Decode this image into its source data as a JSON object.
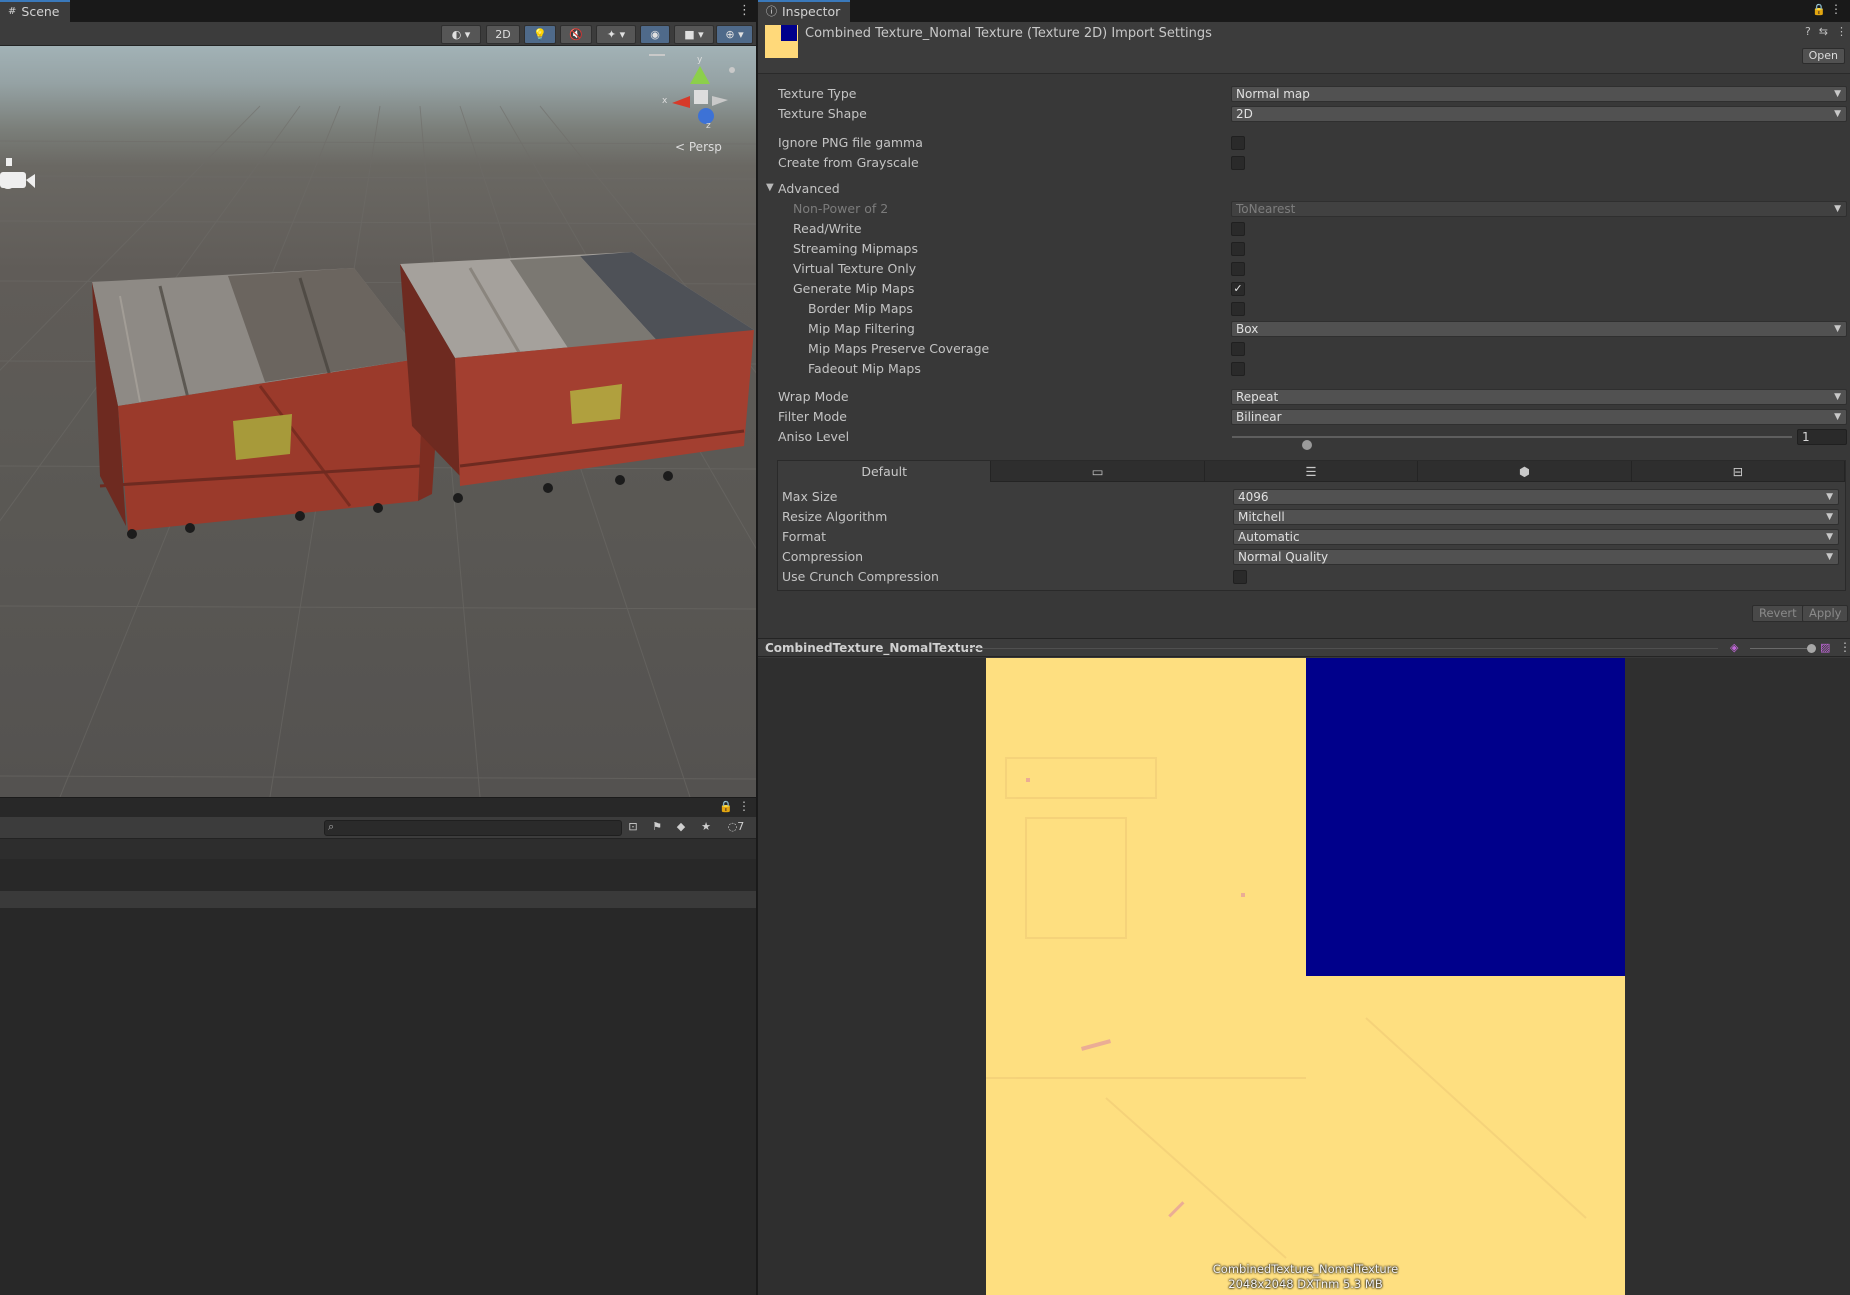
{
  "scene": {
    "tab_label": "Scene",
    "toolbar": {
      "mode_2d": "2D"
    },
    "camera_label": "Persp",
    "gizmo": {
      "y": "y",
      "x": "x",
      "z": "z"
    }
  },
  "hierarchy": {
    "search_placeholder": "",
    "hidden_count": "7"
  },
  "inspector": {
    "tab_label": "Inspector",
    "title": "Combined Texture_Nomal Texture (Texture 2D) Import Settings",
    "open_label": "Open",
    "texture_type": {
      "label": "Texture Type",
      "value": "Normal map"
    },
    "texture_shape": {
      "label": "Texture Shape",
      "value": "2D"
    },
    "ignore_png_gamma": {
      "label": "Ignore PNG file gamma",
      "checked": false
    },
    "create_from_grayscale": {
      "label": "Create from Grayscale",
      "checked": false
    },
    "advanced": {
      "label": "Advanced",
      "non_power_of_2": {
        "label": "Non-Power of 2",
        "value": "ToNearest"
      },
      "read_write": {
        "label": "Read/Write",
        "checked": false
      },
      "streaming_mipmaps": {
        "label": "Streaming Mipmaps",
        "checked": false
      },
      "virtual_texture_only": {
        "label": "Virtual Texture Only",
        "checked": false
      },
      "generate_mip_maps": {
        "label": "Generate Mip Maps",
        "checked": true,
        "check_glyph": "✓"
      },
      "border_mip_maps": {
        "label": "Border Mip Maps",
        "checked": false
      },
      "mip_map_filtering": {
        "label": "Mip Map Filtering",
        "value": "Box"
      },
      "mip_maps_preserve_coverage": {
        "label": "Mip Maps Preserve Coverage",
        "checked": false
      },
      "fadeout_mip_maps": {
        "label": "Fadeout Mip Maps",
        "checked": false
      }
    },
    "wrap_mode": {
      "label": "Wrap Mode",
      "value": "Repeat"
    },
    "filter_mode": {
      "label": "Filter Mode",
      "value": "Bilinear"
    },
    "aniso_level": {
      "label": "Aniso Level",
      "value": "1",
      "min": 0,
      "max": 16
    },
    "platform_tabs": [
      "Default"
    ],
    "platform_tab_icons": [
      "monitor-icon",
      "server-icon",
      "android-icon",
      "webgl-icon"
    ],
    "max_size": {
      "label": "Max Size",
      "value": "4096"
    },
    "resize_algorithm": {
      "label": "Resize Algorithm",
      "value": "Mitchell"
    },
    "format": {
      "label": "Format",
      "value": "Automatic"
    },
    "compression": {
      "label": "Compression",
      "value": "Normal Quality"
    },
    "use_crunch": {
      "label": "Use Crunch Compression",
      "checked": false
    },
    "revert_label": "Revert",
    "apply_label": "Apply"
  },
  "preview": {
    "name": "CombinedTexture_NomalTexture",
    "caption_name": "CombinedTexture_NomalTexture",
    "caption_info": "2048x2048  DXTnm   5.3 MB",
    "colors": {
      "normal_base": "#fedf80",
      "blue_quad": "#00008b"
    }
  },
  "colors": {
    "accent": "#3a79bb",
    "panel": "#383838",
    "toolbar": "#3c3c3c",
    "dumpster_red": "#9b3a2b"
  }
}
